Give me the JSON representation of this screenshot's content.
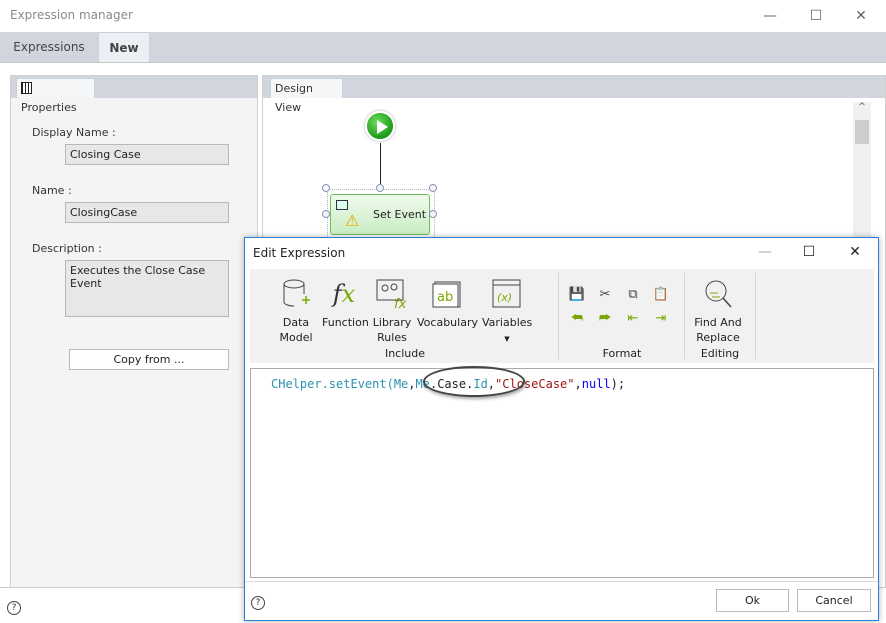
{
  "window": {
    "title": "Expression manager"
  },
  "tabs": [
    {
      "label": "Expressions"
    },
    {
      "label": "New",
      "selected": true
    }
  ],
  "properties": {
    "tab_label": "Properties",
    "display_name_label": "Display Name :",
    "display_name_value": "Closing Case",
    "name_label": "Name :",
    "name_value": "ClosingCase",
    "description_label": "Description :",
    "description_value": "Executes the Close Case Event",
    "copy_button": "Copy from ..."
  },
  "design_view": {
    "tab_label": "Design View",
    "node_label": "Set Event"
  },
  "dialog": {
    "title": "Edit Expression",
    "ribbon": {
      "include": {
        "label": "Include",
        "items": [
          {
            "label": "Data\nModel",
            "icon": "database-icon"
          },
          {
            "label": "Function",
            "icon": "function-icon"
          },
          {
            "label": "Library\nRules",
            "icon": "library-rules-icon"
          },
          {
            "label": "Vocabulary",
            "icon": "vocabulary-icon"
          },
          {
            "label": "Variables",
            "icon": "variables-icon"
          }
        ]
      },
      "format": {
        "label": "Format"
      },
      "editing": {
        "label": "Editing",
        "find_replace": "Find And\nReplace"
      }
    },
    "code": {
      "parts": [
        "CHelper.setEvent(",
        "Me",
        ",",
        "Me",
        ".",
        "Case",
        ".",
        "Id",
        ",",
        "\"CloseCase\"",
        ",",
        "null",
        ");"
      ]
    },
    "ok": "Ok",
    "cancel": "Cancel"
  },
  "colors": {
    "code_identifier": "#2b91af",
    "code_keyword": "#0000ff",
    "code_string": "#a31515",
    "accent": "#2a7fd4"
  }
}
